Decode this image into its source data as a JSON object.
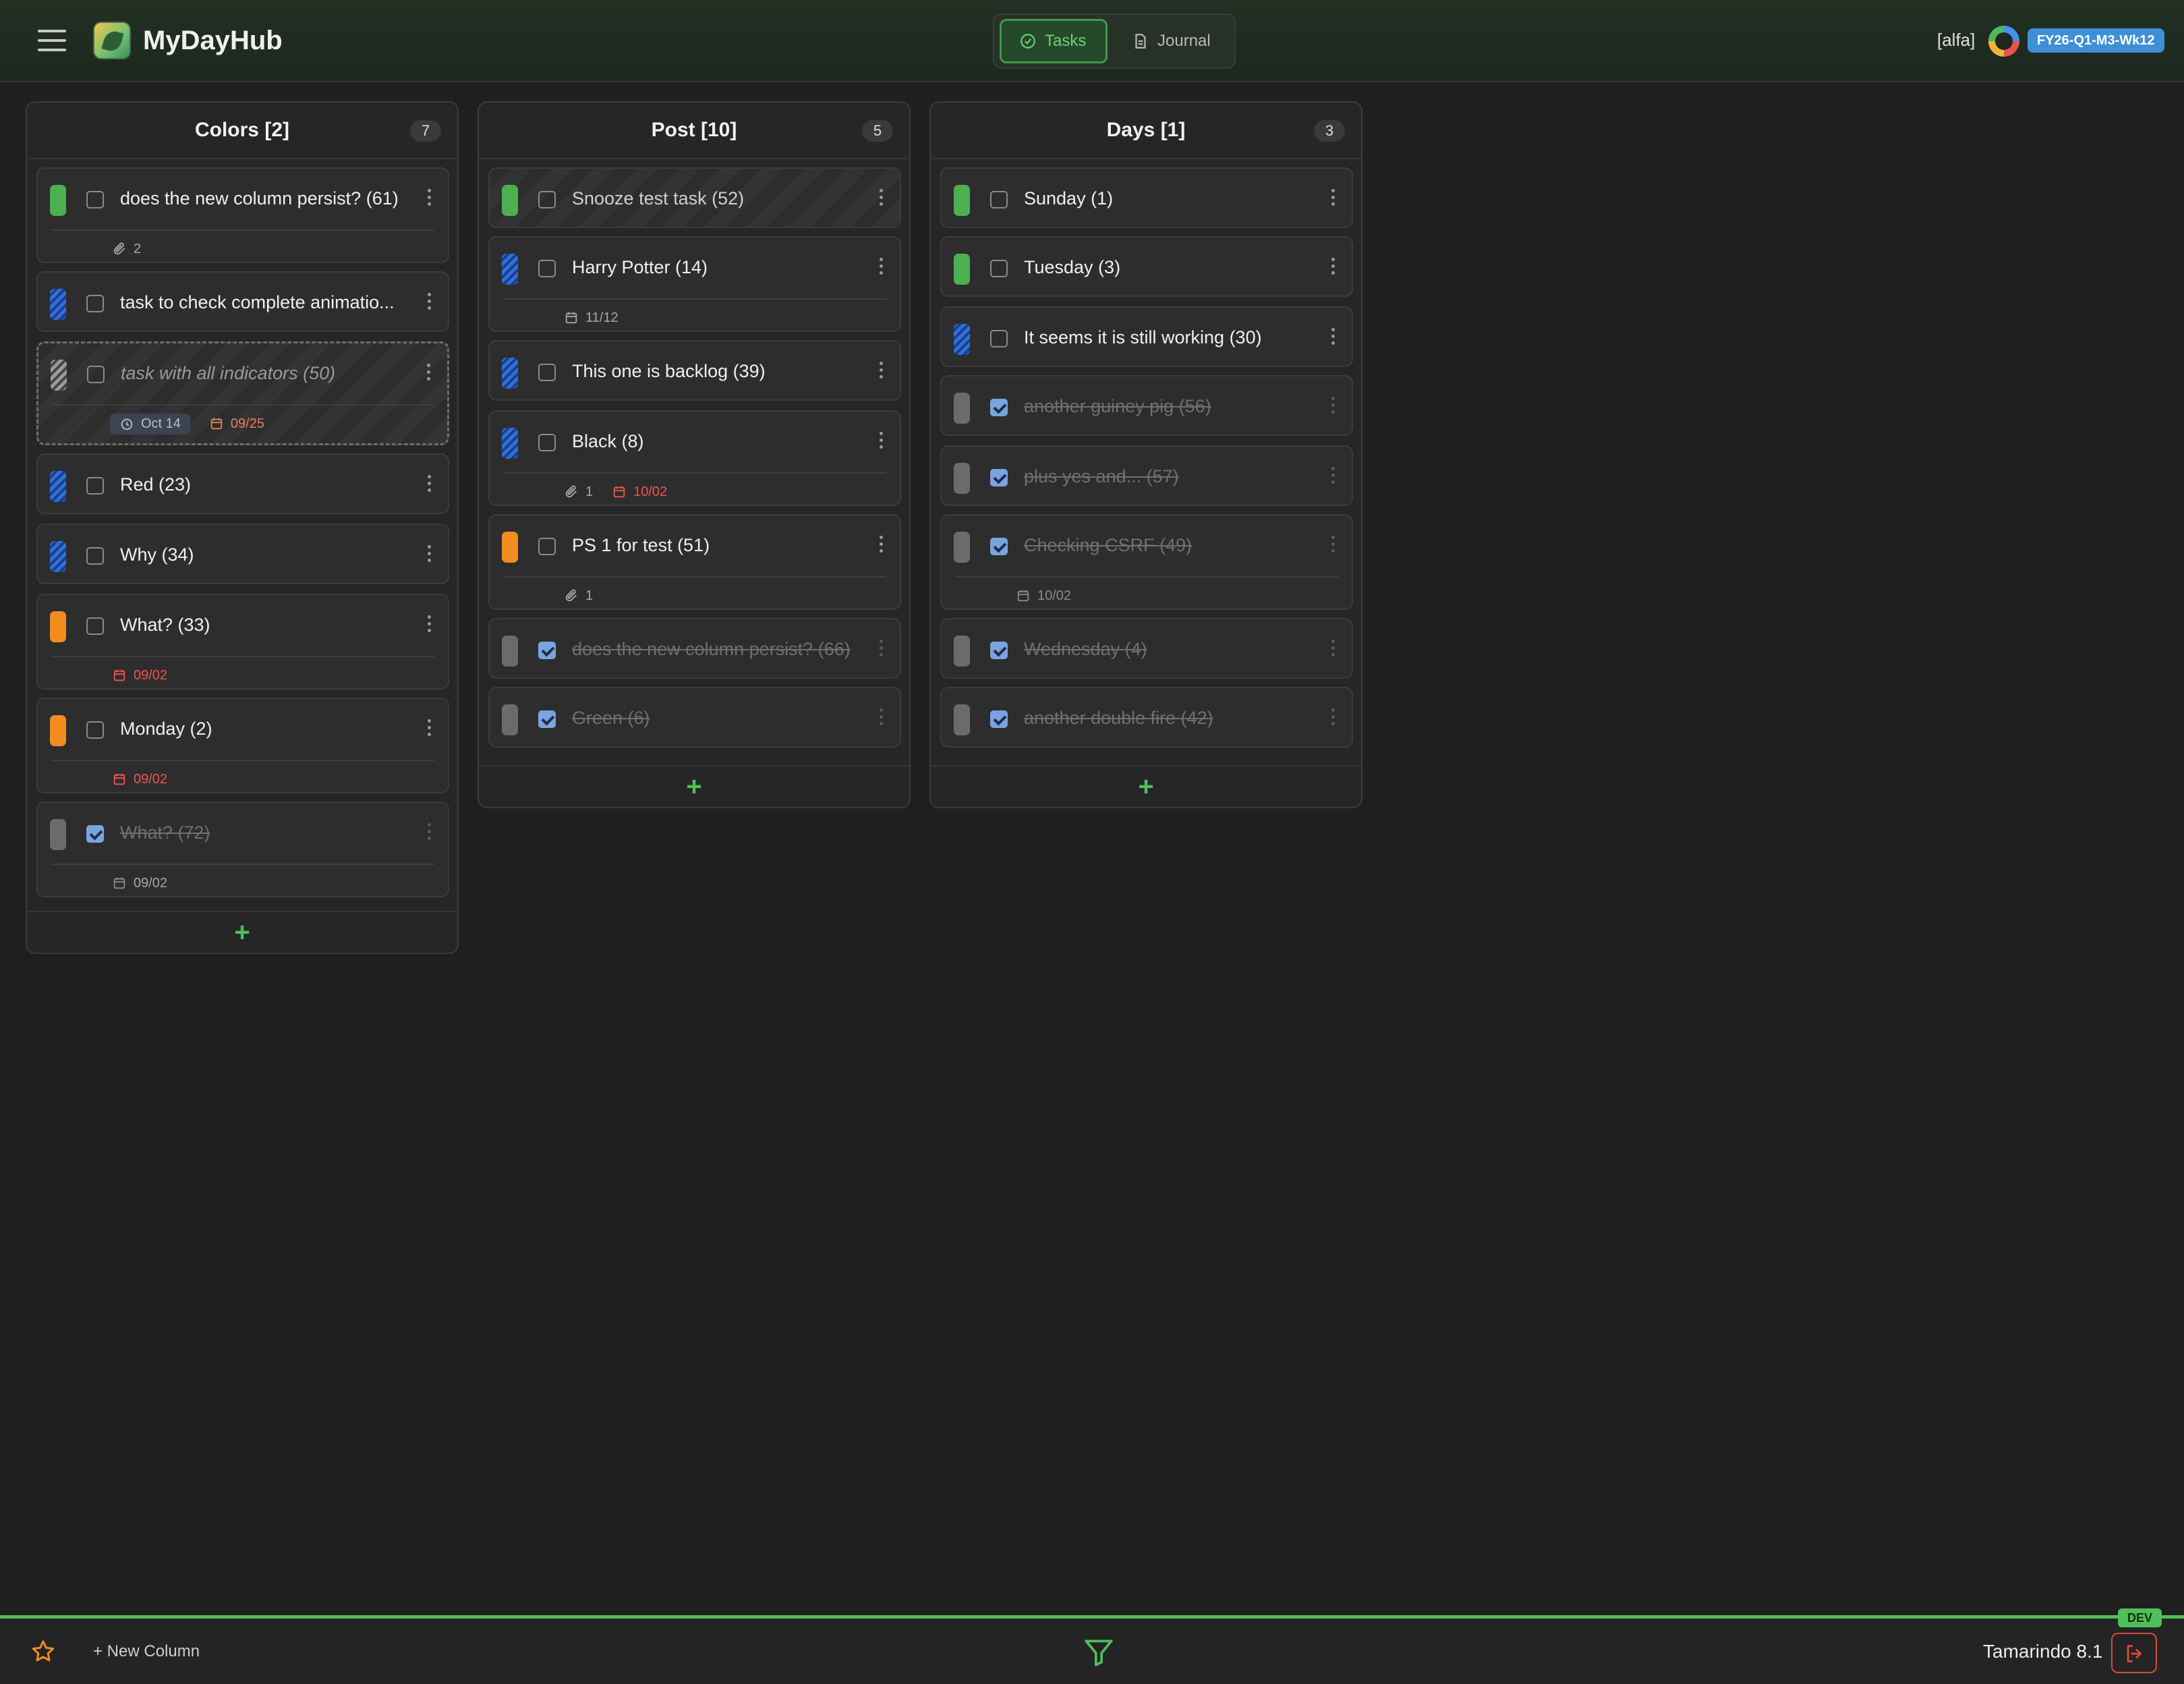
{
  "header": {
    "app_title": "MyDayHub",
    "views": {
      "tasks": "Tasks",
      "journal": "Journal"
    },
    "user": "[alfa]",
    "week_badge": "FY26-Q1-M3-Wk12"
  },
  "columns": [
    {
      "title": "Colors [2]",
      "count": "7",
      "tasks": [
        {
          "text": "does the new column persist? (61)",
          "color": "green",
          "done": false,
          "attachments": "2"
        },
        {
          "text": "task to check complete animatio...",
          "color": "blue-striped",
          "done": false
        },
        {
          "text": "task with all indicators (50)",
          "color": "gray-striped",
          "done": false,
          "snooze": "Oct 14",
          "due": "09/25"
        },
        {
          "text": "Red (23)",
          "color": "blue-striped",
          "done": false
        },
        {
          "text": "Why (34)",
          "color": "blue-striped",
          "done": false
        },
        {
          "text": "What? (33)",
          "color": "orange",
          "done": false,
          "due": "09/02"
        },
        {
          "text": "Monday (2)",
          "color": "orange",
          "done": false,
          "due": "09/02"
        },
        {
          "text": "What? (72)",
          "color": "gray",
          "done": true,
          "due": "09/02"
        }
      ]
    },
    {
      "title": "Post [10]",
      "count": "5",
      "tasks": [
        {
          "text": "Snooze test task (52)",
          "color": "green",
          "done": false
        },
        {
          "text": "Harry Potter (14)",
          "color": "blue-striped",
          "done": false,
          "due": "11/12"
        },
        {
          "text": "This one is backlog (39)",
          "color": "blue-striped",
          "done": false
        },
        {
          "text": "Black (8)",
          "color": "blue-striped",
          "done": false,
          "attachments": "1",
          "due": "10/02"
        },
        {
          "text": "PS 1 for test (51)",
          "color": "orange",
          "done": false,
          "attachments": "1"
        },
        {
          "text": "does the new column persist? (66)",
          "color": "gray",
          "done": true
        },
        {
          "text": "Green (6)",
          "color": "gray",
          "done": true
        }
      ]
    },
    {
      "title": "Days [1]",
      "count": "3",
      "tasks": [
        {
          "text": "Sunday (1)",
          "color": "green",
          "done": false
        },
        {
          "text": "Tuesday (3)",
          "color": "green",
          "done": false
        },
        {
          "text": "It seems it is still working (30)",
          "color": "blue-striped",
          "done": false
        },
        {
          "text": "another guiney pig (56)",
          "color": "gray",
          "done": true
        },
        {
          "text": "plus yes and... (57)",
          "color": "gray",
          "done": true
        },
        {
          "text": "Checking CSRF (49)",
          "color": "gray",
          "done": true,
          "due": "10/02"
        },
        {
          "text": "Wednesday (4)",
          "color": "gray",
          "done": true
        },
        {
          "text": "another double fire (42)",
          "color": "gray",
          "done": true
        }
      ]
    }
  ],
  "add_label": "+",
  "footer": {
    "new_column": "+ New Column",
    "version": "Tamarindo 8.1",
    "env_badge": "DEV"
  },
  "colors": {
    "accent": "#4fbf5a",
    "green": "#4caf50",
    "orange": "#f28c1f",
    "blue": "#2f6fe0",
    "due_red": "#ef5350"
  }
}
